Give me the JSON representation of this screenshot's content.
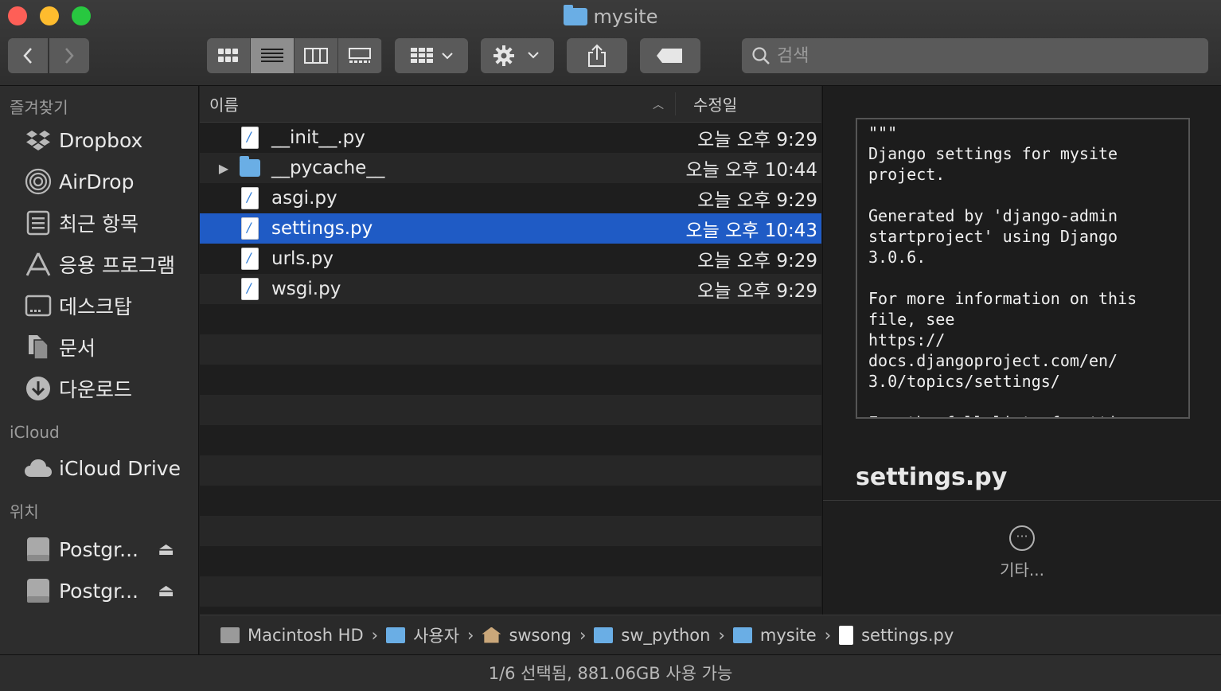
{
  "window": {
    "title": "mysite"
  },
  "toolbar": {
    "back_icon": "chevron-left-icon",
    "forward_icon": "chevron-right-icon",
    "views": [
      "icon-view",
      "list-view",
      "column-view",
      "gallery-view"
    ],
    "active_view": "list-view",
    "search_placeholder": "검색"
  },
  "sidebar": {
    "favorites_header": "즐겨찾기",
    "favorites": [
      {
        "label": "Dropbox",
        "icon": "dropbox-icon"
      },
      {
        "label": "AirDrop",
        "icon": "airdrop-icon"
      },
      {
        "label": "최근 항목",
        "icon": "recents-icon"
      },
      {
        "label": "응용 프로그램",
        "icon": "applications-icon"
      },
      {
        "label": "데스크탑",
        "icon": "desktop-icon"
      },
      {
        "label": "문서",
        "icon": "documents-icon"
      },
      {
        "label": "다운로드",
        "icon": "downloads-icon"
      }
    ],
    "icloud_header": "iCloud",
    "icloud": [
      {
        "label": "iCloud Drive",
        "icon": "cloud-icon"
      }
    ],
    "locations_header": "위치",
    "locations": [
      {
        "label": "Postgr...",
        "icon": "disk-icon"
      },
      {
        "label": "Postgr...",
        "icon": "disk-icon"
      }
    ]
  },
  "list": {
    "col_name": "이름",
    "col_date": "수정일",
    "rows": [
      {
        "name": "__init__.py",
        "date": "오늘 오후 9:29",
        "kind": "py"
      },
      {
        "name": "__pycache__",
        "date": "오늘 오후 10:44",
        "kind": "folder"
      },
      {
        "name": "asgi.py",
        "date": "오늘 오후 9:29",
        "kind": "py"
      },
      {
        "name": "settings.py",
        "date": "오늘 오후 10:43",
        "kind": "py",
        "selected": true
      },
      {
        "name": "urls.py",
        "date": "오늘 오후 9:29",
        "kind": "py"
      },
      {
        "name": "wsgi.py",
        "date": "오늘 오후 9:29",
        "kind": "py"
      }
    ]
  },
  "preview": {
    "content": "\"\"\"\nDjango settings for mysite\nproject.\n\nGenerated by 'django-admin\nstartproject' using Django\n3.0.6.\n\nFor more information on this\nfile, see\nhttps://\ndocs.djangoproject.com/en/\n3.0/topics/settings/\n\nFor the full list of settings",
    "filename": "settings.py",
    "more_label": "기타..."
  },
  "pathbar": [
    {
      "label": "Macintosh HD",
      "icon": "hd"
    },
    {
      "label": "사용자",
      "icon": "folder"
    },
    {
      "label": "swsong",
      "icon": "home"
    },
    {
      "label": "sw_python",
      "icon": "folder"
    },
    {
      "label": "mysite",
      "icon": "folder"
    },
    {
      "label": "settings.py",
      "icon": "file"
    }
  ],
  "status": "1/6 선택됨, 881.06GB 사용 가능",
  "colors": {
    "selection": "#1f5bc5",
    "folder": "#6aaee5"
  }
}
